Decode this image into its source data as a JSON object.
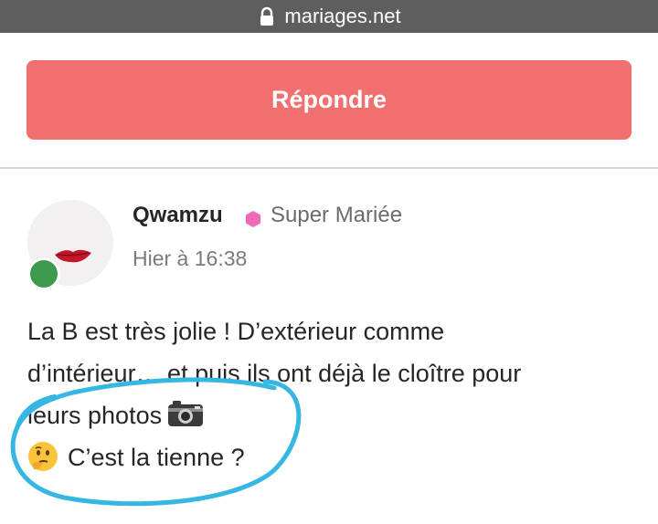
{
  "browser": {
    "url": "mariages.net",
    "lock_icon": "lock-icon"
  },
  "reply_button": {
    "label": "Répondre",
    "color": "#f26f6f"
  },
  "post": {
    "author": "Qwamzu",
    "rank": "Super Mariée",
    "rank_icon": "pink-hexagon-icon",
    "rank_color": "#f06bb3",
    "timestamp": "Hier à 16:38",
    "online_color": "#3d9a4d",
    "lines": [
      "La B est très jolie ! D’extérieur comme",
      "d’intérieur… et puis ils ont déjà le cloître pour",
      "leurs photos",
      "C’est la tienne ?"
    ],
    "emoji_camera": "camera-emoji",
    "emoji_thinking": "thinking-face-emoji"
  },
  "annotation": {
    "color": "#35b6e3"
  }
}
